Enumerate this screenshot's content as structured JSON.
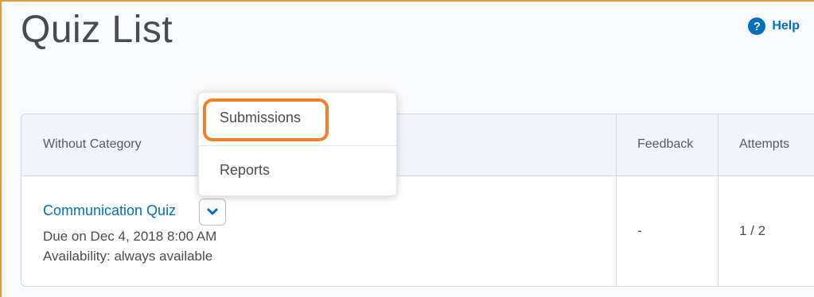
{
  "page": {
    "title": "Quiz List",
    "help_label": "Help",
    "help_icon": "question-circle-icon",
    "accent_color": "#006fbf",
    "frame_border_color": "#e59a3c",
    "highlight_color": "#f0802a"
  },
  "table": {
    "columns": [
      "Without Category",
      "Feedback",
      "Attempts"
    ],
    "rows": [
      {
        "name": "Communication Quiz",
        "due": "Due on Dec 4, 2018 8:00 AM",
        "availability": "Availability: always available",
        "feedback": "-",
        "attempts": "1 / 2"
      }
    ]
  },
  "context_menu": {
    "items": [
      "Submissions",
      "Reports"
    ],
    "highlighted_item": "Submissions"
  }
}
